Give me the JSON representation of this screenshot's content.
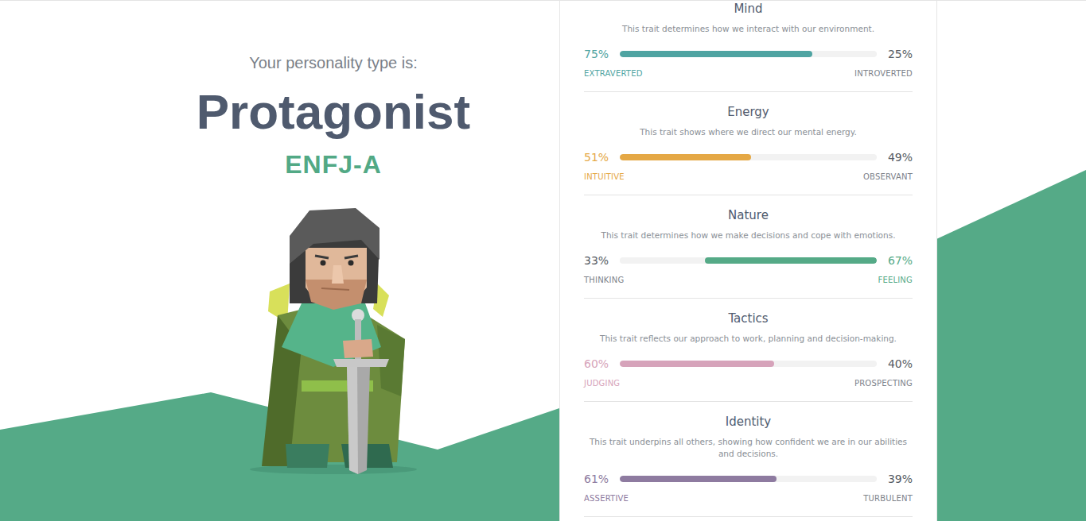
{
  "header": {
    "intro": "Your personality type is:",
    "type_name": "Protagonist",
    "type_code": "ENFJ-A"
  },
  "traits": [
    {
      "name": "Mind",
      "description": "This trait determines how we interact with our environment.",
      "left": {
        "percent": "75%",
        "label": "EXTRAVERTED"
      },
      "right": {
        "percent": "25%",
        "label": "INTROVERTED"
      },
      "dominant": "left",
      "level": 0.75,
      "color": "#4fa4a2"
    },
    {
      "name": "Energy",
      "description": "This trait shows where we direct our mental energy.",
      "left": {
        "percent": "51%",
        "label": "INTUITIVE"
      },
      "right": {
        "percent": "49%",
        "label": "OBSERVANT"
      },
      "dominant": "left",
      "level": 0.51,
      "color": "#e5a845"
    },
    {
      "name": "Nature",
      "description": "This trait determines how we make decisions and cope with emotions.",
      "left": {
        "percent": "33%",
        "label": "THINKING"
      },
      "right": {
        "percent": "67%",
        "label": "FEELING"
      },
      "dominant": "right",
      "level": 0.67,
      "color": "#55aa87"
    },
    {
      "name": "Tactics",
      "description": "This trait reflects our approach to work, planning and decision-making.",
      "left": {
        "percent": "60%",
        "label": "JUDGING"
      },
      "right": {
        "percent": "40%",
        "label": "PROSPECTING"
      },
      "dominant": "left",
      "level": 0.6,
      "color": "#d6a3ba"
    },
    {
      "name": "Identity",
      "description": "This trait underpins all others, showing how confident we are in our abilities and decisions.",
      "left": {
        "percent": "61%",
        "label": "ASSERTIVE"
      },
      "right": {
        "percent": "39%",
        "label": "TURBULENT"
      },
      "dominant": "left",
      "level": 0.61,
      "color": "#8e7ba0"
    }
  ]
}
